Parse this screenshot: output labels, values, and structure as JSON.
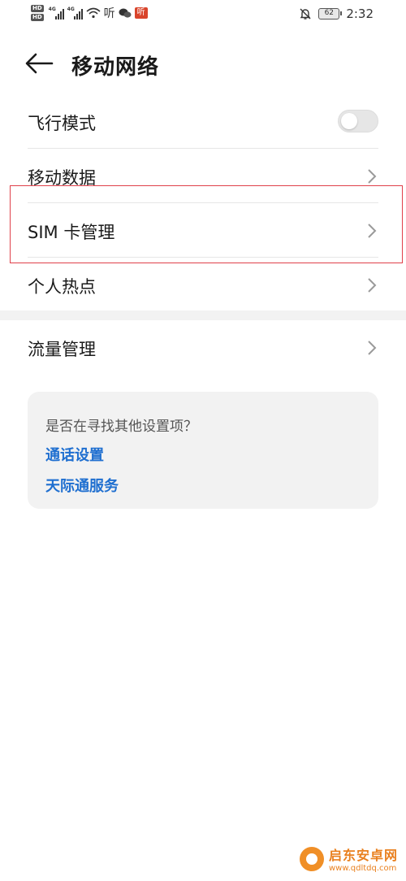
{
  "status_bar": {
    "left_text": "HD",
    "hd_sub": "2",
    "net_left": "4G",
    "net_right": "4G",
    "misc_icon_text": "听",
    "app_badge": "听",
    "battery": "62",
    "time": "2:32"
  },
  "header": {
    "title": "移动网络"
  },
  "list": {
    "items": [
      {
        "label": "飞行模式"
      },
      {
        "label": "移动数据"
      },
      {
        "label": "SIM 卡管理"
      },
      {
        "label": "个人热点"
      }
    ],
    "traffic_label": "流量管理"
  },
  "card": {
    "question": "是否在寻找其他设置项？",
    "links": [
      {
        "label": "通话设置"
      },
      {
        "label": "天际通服务"
      }
    ]
  },
  "watermark": {
    "name": "启东安卓网",
    "url": "www.qdltdq.com"
  },
  "colors": {
    "accent_link": "#1f6fd0",
    "highlight_border": "#e0404a",
    "watermark": "#e87a14"
  },
  "icons": {
    "back": "arrow-left-icon",
    "chevron": "chevron-right-icon",
    "bell_off": "bell-off-icon",
    "wifi": "wifi-icon"
  }
}
